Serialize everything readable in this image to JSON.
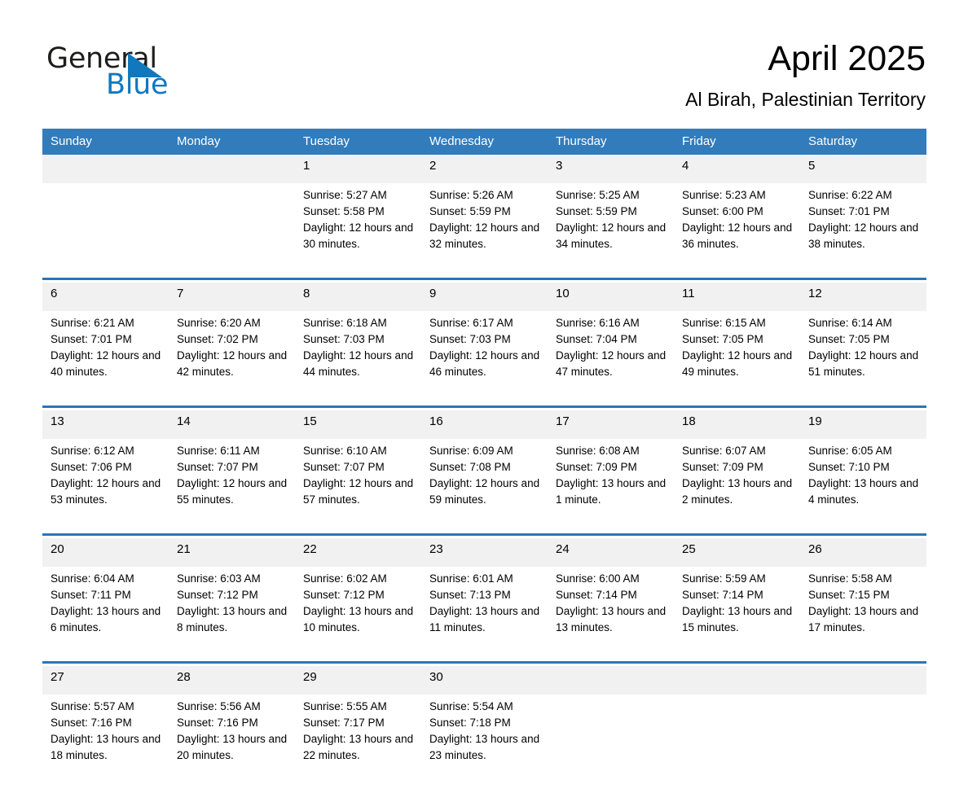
{
  "brand": {
    "word_one": "General",
    "word_two": "Blue",
    "triangle_icon": "triangle-icon"
  },
  "header": {
    "title": "April 2025",
    "subtitle": "Al Birah, Palestinian Territory"
  },
  "colors": {
    "header_blue": "#327cbb",
    "separator_blue": "#2e74b5",
    "daynum_background": "#f1f1f1",
    "brand_blue": "#1278be",
    "text": "#000000"
  },
  "calendar": {
    "weekday_headers": [
      "Sunday",
      "Monday",
      "Tuesday",
      "Wednesday",
      "Thursday",
      "Friday",
      "Saturday"
    ],
    "weeks": [
      [
        {
          "day": "",
          "lines": []
        },
        {
          "day": "",
          "lines": []
        },
        {
          "day": "1",
          "lines": [
            "Sunrise: 5:27 AM",
            "Sunset: 5:58 PM",
            "Daylight: 12 hours and 30 minutes."
          ]
        },
        {
          "day": "2",
          "lines": [
            "Sunrise: 5:26 AM",
            "Sunset: 5:59 PM",
            "Daylight: 12 hours and 32 minutes."
          ]
        },
        {
          "day": "3",
          "lines": [
            "Sunrise: 5:25 AM",
            "Sunset: 5:59 PM",
            "Daylight: 12 hours and 34 minutes."
          ]
        },
        {
          "day": "4",
          "lines": [
            "Sunrise: 5:23 AM",
            "Sunset: 6:00 PM",
            "Daylight: 12 hours and 36 minutes."
          ]
        },
        {
          "day": "5",
          "lines": [
            "Sunrise: 6:22 AM",
            "Sunset: 7:01 PM",
            "Daylight: 12 hours and 38 minutes."
          ]
        }
      ],
      [
        {
          "day": "6",
          "lines": [
            "Sunrise: 6:21 AM",
            "Sunset: 7:01 PM",
            "Daylight: 12 hours and 40 minutes."
          ]
        },
        {
          "day": "7",
          "lines": [
            "Sunrise: 6:20 AM",
            "Sunset: 7:02 PM",
            "Daylight: 12 hours and 42 minutes."
          ]
        },
        {
          "day": "8",
          "lines": [
            "Sunrise: 6:18 AM",
            "Sunset: 7:03 PM",
            "Daylight: 12 hours and 44 minutes."
          ]
        },
        {
          "day": "9",
          "lines": [
            "Sunrise: 6:17 AM",
            "Sunset: 7:03 PM",
            "Daylight: 12 hours and 46 minutes."
          ]
        },
        {
          "day": "10",
          "lines": [
            "Sunrise: 6:16 AM",
            "Sunset: 7:04 PM",
            "Daylight: 12 hours and 47 minutes."
          ]
        },
        {
          "day": "11",
          "lines": [
            "Sunrise: 6:15 AM",
            "Sunset: 7:05 PM",
            "Daylight: 12 hours and 49 minutes."
          ]
        },
        {
          "day": "12",
          "lines": [
            "Sunrise: 6:14 AM",
            "Sunset: 7:05 PM",
            "Daylight: 12 hours and 51 minutes."
          ]
        }
      ],
      [
        {
          "day": "13",
          "lines": [
            "Sunrise: 6:12 AM",
            "Sunset: 7:06 PM",
            "Daylight: 12 hours and 53 minutes."
          ]
        },
        {
          "day": "14",
          "lines": [
            "Sunrise: 6:11 AM",
            "Sunset: 7:07 PM",
            "Daylight: 12 hours and 55 minutes."
          ]
        },
        {
          "day": "15",
          "lines": [
            "Sunrise: 6:10 AM",
            "Sunset: 7:07 PM",
            "Daylight: 12 hours and 57 minutes."
          ]
        },
        {
          "day": "16",
          "lines": [
            "Sunrise: 6:09 AM",
            "Sunset: 7:08 PM",
            "Daylight: 12 hours and 59 minutes."
          ]
        },
        {
          "day": "17",
          "lines": [
            "Sunrise: 6:08 AM",
            "Sunset: 7:09 PM",
            "Daylight: 13 hours and 1 minute."
          ]
        },
        {
          "day": "18",
          "lines": [
            "Sunrise: 6:07 AM",
            "Sunset: 7:09 PM",
            "Daylight: 13 hours and 2 minutes."
          ]
        },
        {
          "day": "19",
          "lines": [
            "Sunrise: 6:05 AM",
            "Sunset: 7:10 PM",
            "Daylight: 13 hours and 4 minutes."
          ]
        }
      ],
      [
        {
          "day": "20",
          "lines": [
            "Sunrise: 6:04 AM",
            "Sunset: 7:11 PM",
            "Daylight: 13 hours and 6 minutes."
          ]
        },
        {
          "day": "21",
          "lines": [
            "Sunrise: 6:03 AM",
            "Sunset: 7:12 PM",
            "Daylight: 13 hours and 8 minutes."
          ]
        },
        {
          "day": "22",
          "lines": [
            "Sunrise: 6:02 AM",
            "Sunset: 7:12 PM",
            "Daylight: 13 hours and 10 minutes."
          ]
        },
        {
          "day": "23",
          "lines": [
            "Sunrise: 6:01 AM",
            "Sunset: 7:13 PM",
            "Daylight: 13 hours and 11 minutes."
          ]
        },
        {
          "day": "24",
          "lines": [
            "Sunrise: 6:00 AM",
            "Sunset: 7:14 PM",
            "Daylight: 13 hours and 13 minutes."
          ]
        },
        {
          "day": "25",
          "lines": [
            "Sunrise: 5:59 AM",
            "Sunset: 7:14 PM",
            "Daylight: 13 hours and 15 minutes."
          ]
        },
        {
          "day": "26",
          "lines": [
            "Sunrise: 5:58 AM",
            "Sunset: 7:15 PM",
            "Daylight: 13 hours and 17 minutes."
          ]
        }
      ],
      [
        {
          "day": "27",
          "lines": [
            "Sunrise: 5:57 AM",
            "Sunset: 7:16 PM",
            "Daylight: 13 hours and 18 minutes."
          ]
        },
        {
          "day": "28",
          "lines": [
            "Sunrise: 5:56 AM",
            "Sunset: 7:16 PM",
            "Daylight: 13 hours and 20 minutes."
          ]
        },
        {
          "day": "29",
          "lines": [
            "Sunrise: 5:55 AM",
            "Sunset: 7:17 PM",
            "Daylight: 13 hours and 22 minutes."
          ]
        },
        {
          "day": "30",
          "lines": [
            "Sunrise: 5:54 AM",
            "Sunset: 7:18 PM",
            "Daylight: 13 hours and 23 minutes."
          ]
        },
        {
          "day": "",
          "lines": []
        },
        {
          "day": "",
          "lines": []
        },
        {
          "day": "",
          "lines": []
        }
      ]
    ]
  }
}
